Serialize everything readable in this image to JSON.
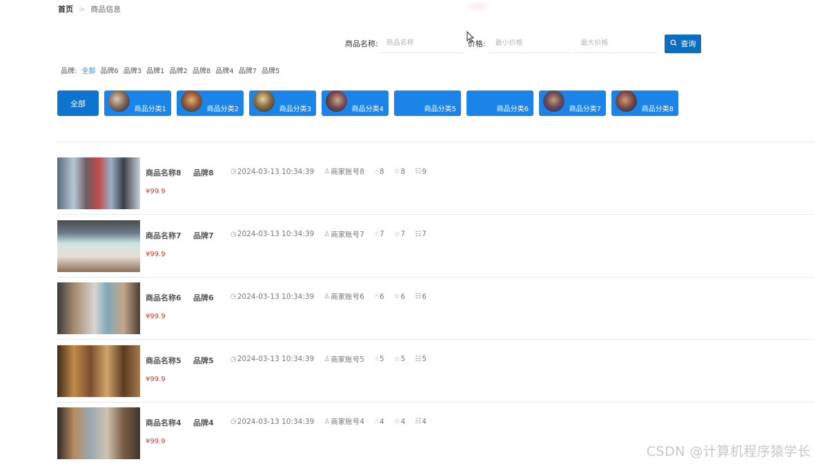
{
  "breadcrumb": {
    "home": "首页",
    "separator": ">",
    "current": "商品信息"
  },
  "search": {
    "name_label": "商品名称:",
    "name_placeholder": "商品名称",
    "price_label": "价格:",
    "min_price_placeholder": "最小价格",
    "max_price_placeholder": "最大价格",
    "query_button": "查询",
    "query_icon": "search-icon"
  },
  "brands": {
    "label": "品牌:",
    "items": [
      "全部",
      "品牌6",
      "品牌3",
      "品牌1",
      "品牌2",
      "品牌8",
      "品牌4",
      "品牌7",
      "品牌5"
    ],
    "active": "全部"
  },
  "categories": {
    "all_label": "全部",
    "items": [
      "商品分类1",
      "商品分类2",
      "商品分类3",
      "商品分类4",
      "商品分类5",
      "商品分类6",
      "商品分类7",
      "商品分类8"
    ]
  },
  "products": [
    {
      "name": "商品名称8",
      "brand": "品牌8",
      "time": "2024-03-13 10:34:39",
      "merchant": "商家账号8",
      "likes": "8",
      "favorites": "8",
      "comments": "9",
      "price": "¥99.9"
    },
    {
      "name": "商品名称7",
      "brand": "品牌7",
      "time": "2024-03-13 10:34:39",
      "merchant": "商家账号7",
      "likes": "7",
      "favorites": "7",
      "comments": "7",
      "price": "¥99.9"
    },
    {
      "name": "商品名称6",
      "brand": "品牌6",
      "time": "2024-03-13 10:34:39",
      "merchant": "商家账号6",
      "likes": "6",
      "favorites": "6",
      "comments": "6",
      "price": "¥99.9"
    },
    {
      "name": "商品名称5",
      "brand": "品牌5",
      "time": "2024-03-13 10:34:39",
      "merchant": "商家账号5",
      "likes": "5",
      "favorites": "5",
      "comments": "5",
      "price": "¥99.9"
    },
    {
      "name": "商品名称4",
      "brand": "品牌4",
      "time": "2024-03-13 10:34:39",
      "merchant": "商家账号4",
      "likes": "4",
      "favorites": "4",
      "comments": "4",
      "price": "¥99.9"
    }
  ],
  "icons": {
    "time": "clock-icon",
    "merchant": "user-icon",
    "likes": "thumbs-up-icon",
    "favorites": "star-icon",
    "comments": "comment-icon"
  },
  "watermark": "CSDN @计算机程序猿学长",
  "colors": {
    "primary": "#1a84e8",
    "button_dark": "#0d6ebd",
    "price": "#c0392b",
    "active_brand": "#1e88e5"
  }
}
